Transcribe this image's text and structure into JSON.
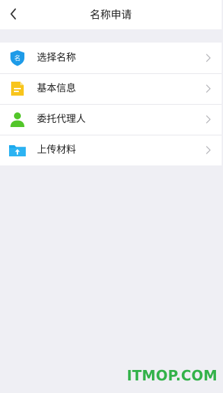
{
  "header": {
    "title": "名称申请",
    "back_icon": "chevron-left-icon"
  },
  "menu": {
    "items": [
      {
        "label": "选择名称",
        "icon": "name-badge-icon",
        "icon_text": "名",
        "color": "#1e9be8"
      },
      {
        "label": "基本信息",
        "icon": "document-icon",
        "color": "#f8c51c"
      },
      {
        "label": "委托代理人",
        "icon": "person-icon",
        "color": "#53c62a"
      },
      {
        "label": "上传材料",
        "icon": "upload-folder-icon",
        "color": "#1ca9ee"
      }
    ],
    "chevron_icon": "chevron-right-icon"
  },
  "watermark": {
    "text": "ITMOP.COM",
    "color": "#33b24a"
  }
}
